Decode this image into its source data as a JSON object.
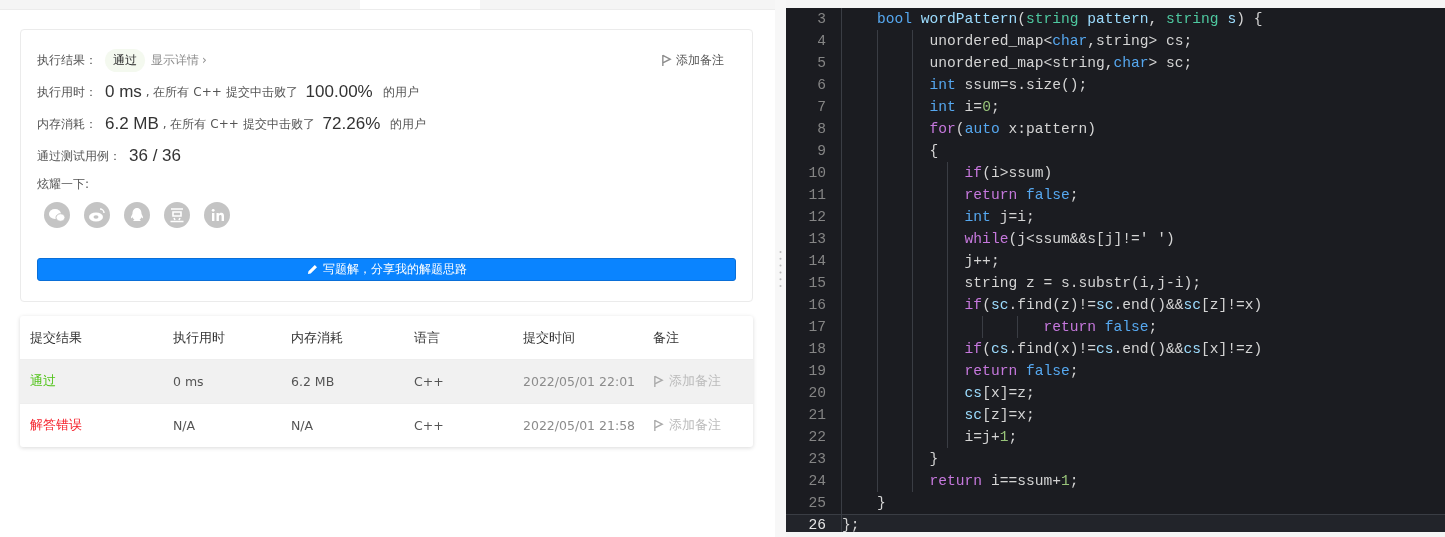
{
  "result": {
    "label": "执行结果：",
    "status": "通过",
    "details_link": "显示详情",
    "details_chevron": "›",
    "note_button": "添加备注"
  },
  "stats": [
    {
      "label": "执行用时：",
      "value": "0 ms",
      "text": ", 在所有 C++ 提交中击败了",
      "percent": "100.00%",
      "suffix": "的用户"
    },
    {
      "label": "内存消耗：",
      "value": "6.2 MB",
      "text": ", 在所有 C++ 提交中击败了",
      "percent": "72.26%",
      "suffix": "的用户"
    }
  ],
  "tests": {
    "label": "通过测试用例：",
    "value": "36 / 36"
  },
  "share": {
    "label": "炫耀一下:",
    "icons": [
      {
        "kind": "wechat"
      },
      {
        "kind": "weibo"
      },
      {
        "kind": "qq"
      },
      {
        "kind": "douban"
      },
      {
        "kind": "linkedin"
      }
    ]
  },
  "write_button": "写题解，分享我的解题思路",
  "table": {
    "columns": [
      "提交结果",
      "执行用时",
      "内存消耗",
      "语言",
      "提交时间",
      "备注"
    ],
    "rows": [
      {
        "status": "通过",
        "color": "#52c41a",
        "time": "0 ms",
        "memory": "6.2 MB",
        "language": "C++",
        "submitted": "2022/05/01 22:01",
        "note": "添加备注",
        "highlighted": true
      },
      {
        "status": "解答错误",
        "color": "#f5222d",
        "time": "N/A",
        "memory": "N/A",
        "language": "C++",
        "submitted": "2022/05/01 21:58",
        "note": "添加备注",
        "highlighted": false
      }
    ]
  },
  "code": [
    {
      "number": "3",
      "active": false,
      "tokens": [
        {
          "kind": "type",
          "text": "    bool "
        },
        {
          "kind": "var",
          "text": "wordPattern"
        },
        {
          "kind": "plain",
          "text": "("
        },
        {
          "kind": "cls",
          "text": "string "
        },
        {
          "kind": "var",
          "text": "pattern"
        },
        {
          "kind": "plain",
          "text": ", "
        },
        {
          "kind": "cls",
          "text": "string "
        },
        {
          "kind": "var",
          "text": "s"
        },
        {
          "kind": "plain",
          "text": ") {"
        }
      ]
    },
    {
      "number": "4",
      "active": false,
      "tokens": [
        {
          "kind": "plain",
          "text": "          unordered_map<"
        },
        {
          "kind": "type",
          "text": "char"
        },
        {
          "kind": "plain",
          "text": ",string> cs;"
        }
      ]
    },
    {
      "number": "5",
      "active": false,
      "tokens": [
        {
          "kind": "plain",
          "text": "          unordered_map<string,"
        },
        {
          "kind": "type",
          "text": "char"
        },
        {
          "kind": "plain",
          "text": "> sc;"
        }
      ]
    },
    {
      "number": "6",
      "active": false,
      "tokens": [
        {
          "kind": "type",
          "text": "          int"
        },
        {
          "kind": "plain",
          "text": " ssum=s.size();"
        }
      ]
    },
    {
      "number": "7",
      "active": false,
      "tokens": [
        {
          "kind": "type",
          "text": "          int"
        },
        {
          "kind": "plain",
          "text": " i="
        },
        {
          "kind": "num",
          "text": "0"
        },
        {
          "kind": "plain",
          "text": ";"
        }
      ]
    },
    {
      "number": "8",
      "active": false,
      "tokens": [
        {
          "kind": "kw",
          "text": "          for"
        },
        {
          "kind": "plain",
          "text": "("
        },
        {
          "kind": "type",
          "text": "auto"
        },
        {
          "kind": "plain",
          "text": " x:pattern)"
        }
      ]
    },
    {
      "number": "9",
      "active": false,
      "tokens": [
        {
          "kind": "plain",
          "text": "          {"
        }
      ]
    },
    {
      "number": "10",
      "active": false,
      "tokens": [
        {
          "kind": "kw",
          "text": "              if"
        },
        {
          "kind": "plain",
          "text": "(i>ssum)"
        }
      ]
    },
    {
      "number": "11",
      "active": false,
      "tokens": [
        {
          "kind": "kw",
          "text": "              return "
        },
        {
          "kind": "type",
          "text": "false"
        },
        {
          "kind": "plain",
          "text": ";"
        }
      ]
    },
    {
      "number": "12",
      "active": false,
      "tokens": [
        {
          "kind": "type",
          "text": "              int"
        },
        {
          "kind": "plain",
          "text": " j=i;"
        }
      ]
    },
    {
      "number": "13",
      "active": false,
      "tokens": [
        {
          "kind": "kw",
          "text": "              while"
        },
        {
          "kind": "plain",
          "text": "(j<ssum&&s[j]!=' ')"
        }
      ]
    },
    {
      "number": "14",
      "active": false,
      "tokens": [
        {
          "kind": "plain",
          "text": "              j++;"
        }
      ]
    },
    {
      "number": "15",
      "active": false,
      "tokens": [
        {
          "kind": "plain",
          "text": "              string z = s.substr(i,j-i);"
        }
      ]
    },
    {
      "number": "16",
      "active": false,
      "tokens": [
        {
          "kind": "kw",
          "text": "              if"
        },
        {
          "kind": "plain",
          "text": "("
        },
        {
          "kind": "var",
          "text": "sc"
        },
        {
          "kind": "plain",
          "text": ".find(z)!="
        },
        {
          "kind": "var",
          "text": "sc"
        },
        {
          "kind": "plain",
          "text": ".end()&&"
        },
        {
          "kind": "var",
          "text": "sc"
        },
        {
          "kind": "plain",
          "text": "[z]!=x)"
        }
      ]
    },
    {
      "number": "17",
      "active": false,
      "tokens": [
        {
          "kind": "kw",
          "text": "                       return "
        },
        {
          "kind": "type",
          "text": "false"
        },
        {
          "kind": "plain",
          "text": ";"
        }
      ]
    },
    {
      "number": "18",
      "active": false,
      "tokens": [
        {
          "kind": "kw",
          "text": "              if"
        },
        {
          "kind": "plain",
          "text": "("
        },
        {
          "kind": "var",
          "text": "cs"
        },
        {
          "kind": "plain",
          "text": ".find(x)!="
        },
        {
          "kind": "var",
          "text": "cs"
        },
        {
          "kind": "plain",
          "text": ".end()&&"
        },
        {
          "kind": "var",
          "text": "cs"
        },
        {
          "kind": "plain",
          "text": "[x]!=z)"
        }
      ]
    },
    {
      "number": "19",
      "active": false,
      "tokens": [
        {
          "kind": "kw",
          "text": "              return "
        },
        {
          "kind": "type",
          "text": "false"
        },
        {
          "kind": "plain",
          "text": ";"
        }
      ]
    },
    {
      "number": "20",
      "active": false,
      "tokens": [
        {
          "kind": "var",
          "text": "              cs"
        },
        {
          "kind": "plain",
          "text": "[x]=z;"
        }
      ]
    },
    {
      "number": "21",
      "active": false,
      "tokens": [
        {
          "kind": "var",
          "text": "              sc"
        },
        {
          "kind": "plain",
          "text": "[z]=x;"
        }
      ]
    },
    {
      "number": "22",
      "active": false,
      "tokens": [
        {
          "kind": "plain",
          "text": "              i=j+"
        },
        {
          "kind": "num",
          "text": "1"
        },
        {
          "kind": "plain",
          "text": ";"
        }
      ]
    },
    {
      "number": "23",
      "active": false,
      "tokens": [
        {
          "kind": "plain",
          "text": "          }"
        }
      ]
    },
    {
      "number": "24",
      "active": false,
      "tokens": [
        {
          "kind": "kw",
          "text": "          return "
        },
        {
          "kind": "plain",
          "text": "i==ssum+"
        },
        {
          "kind": "num",
          "text": "1"
        },
        {
          "kind": "plain",
          "text": ";"
        }
      ]
    },
    {
      "number": "25",
      "active": false,
      "tokens": [
        {
          "kind": "plain",
          "text": "    }"
        }
      ]
    },
    {
      "number": "26",
      "active": true,
      "tokens": [
        {
          "kind": "plain",
          "text": "};"
        }
      ]
    }
  ]
}
